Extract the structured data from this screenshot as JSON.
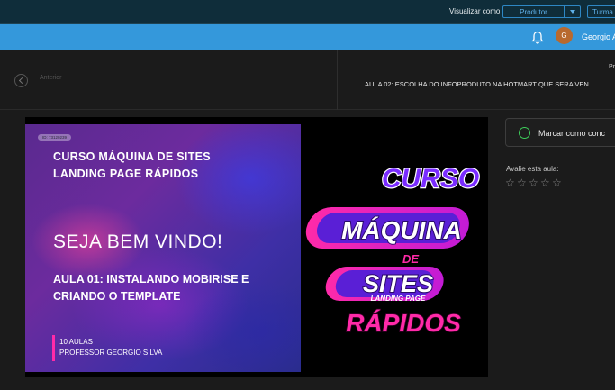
{
  "topbar": {
    "view_as_label": "Visualizar como",
    "view_as_value": "Produtor",
    "turma_label": "Turma"
  },
  "header": {
    "avatar_initial": "G",
    "user_name": "Georgio A"
  },
  "nav": {
    "prev_label": "Anterior",
    "next_small": "Pr",
    "next_title": "AULA 02: ESCOLHA DO INFOPRODUTO NA HOTMART QUE SERA VEN"
  },
  "slide": {
    "id_tag": "ID: 73120239",
    "title_line1": "CURSO MÁQUINA DE SITES",
    "title_line2": "LANDING PAGE RÁPIDOS",
    "welcome": "SEJA BEM VINDO!",
    "lesson_line1": "AULA 01: INSTALANDO MOBIRISE E",
    "lesson_line2": "CRIANDO O TEMPLATE",
    "count": "10 AULAS",
    "professor": "PROFESSOR GEORGIO SILVA"
  },
  "logo": {
    "curso": "CURSO",
    "maquina": "MÁQUINA",
    "de": "DE",
    "sites": "SITES",
    "landing": "LANDING PAGE",
    "rapidos": "RÁPIDOS"
  },
  "sidebar": {
    "mark_complete": "Marcar como conc",
    "rate_label": "Avalie esta aula:",
    "stars": [
      "☆",
      "☆",
      "☆",
      "☆",
      "☆"
    ],
    "rating": 0
  },
  "colors": {
    "topbar": "#0f2d3a",
    "bluebar": "#3498db",
    "accent_green": "#3ecf5a",
    "avatar": "#b8692e"
  }
}
